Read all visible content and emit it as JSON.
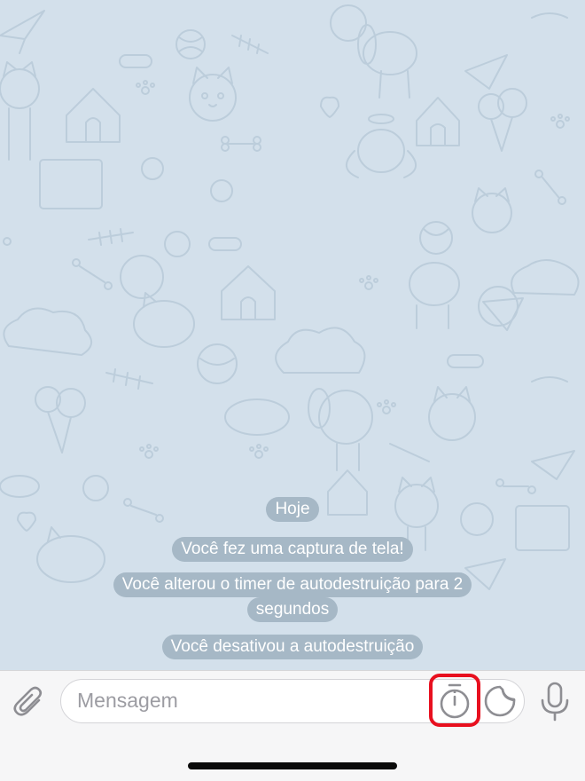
{
  "chat": {
    "date_label": "Hoje",
    "service_messages": [
      "Você fez uma captura de tela!",
      "Você alterou o timer de autodestruição para 2",
      "segundos",
      "Você desativou a autodestruição"
    ]
  },
  "composer": {
    "placeholder": "Mensagem",
    "attach_icon": "paperclip-icon",
    "timer_icon": "stopwatch-icon",
    "sticker_icon": "sticker-icon",
    "mic_icon": "microphone-icon"
  },
  "colors": {
    "wallpaper": "#d3e0eb",
    "bubble": "#a6b8c6",
    "icon_gray": "#8e8e93",
    "highlight": "#e8101f"
  }
}
